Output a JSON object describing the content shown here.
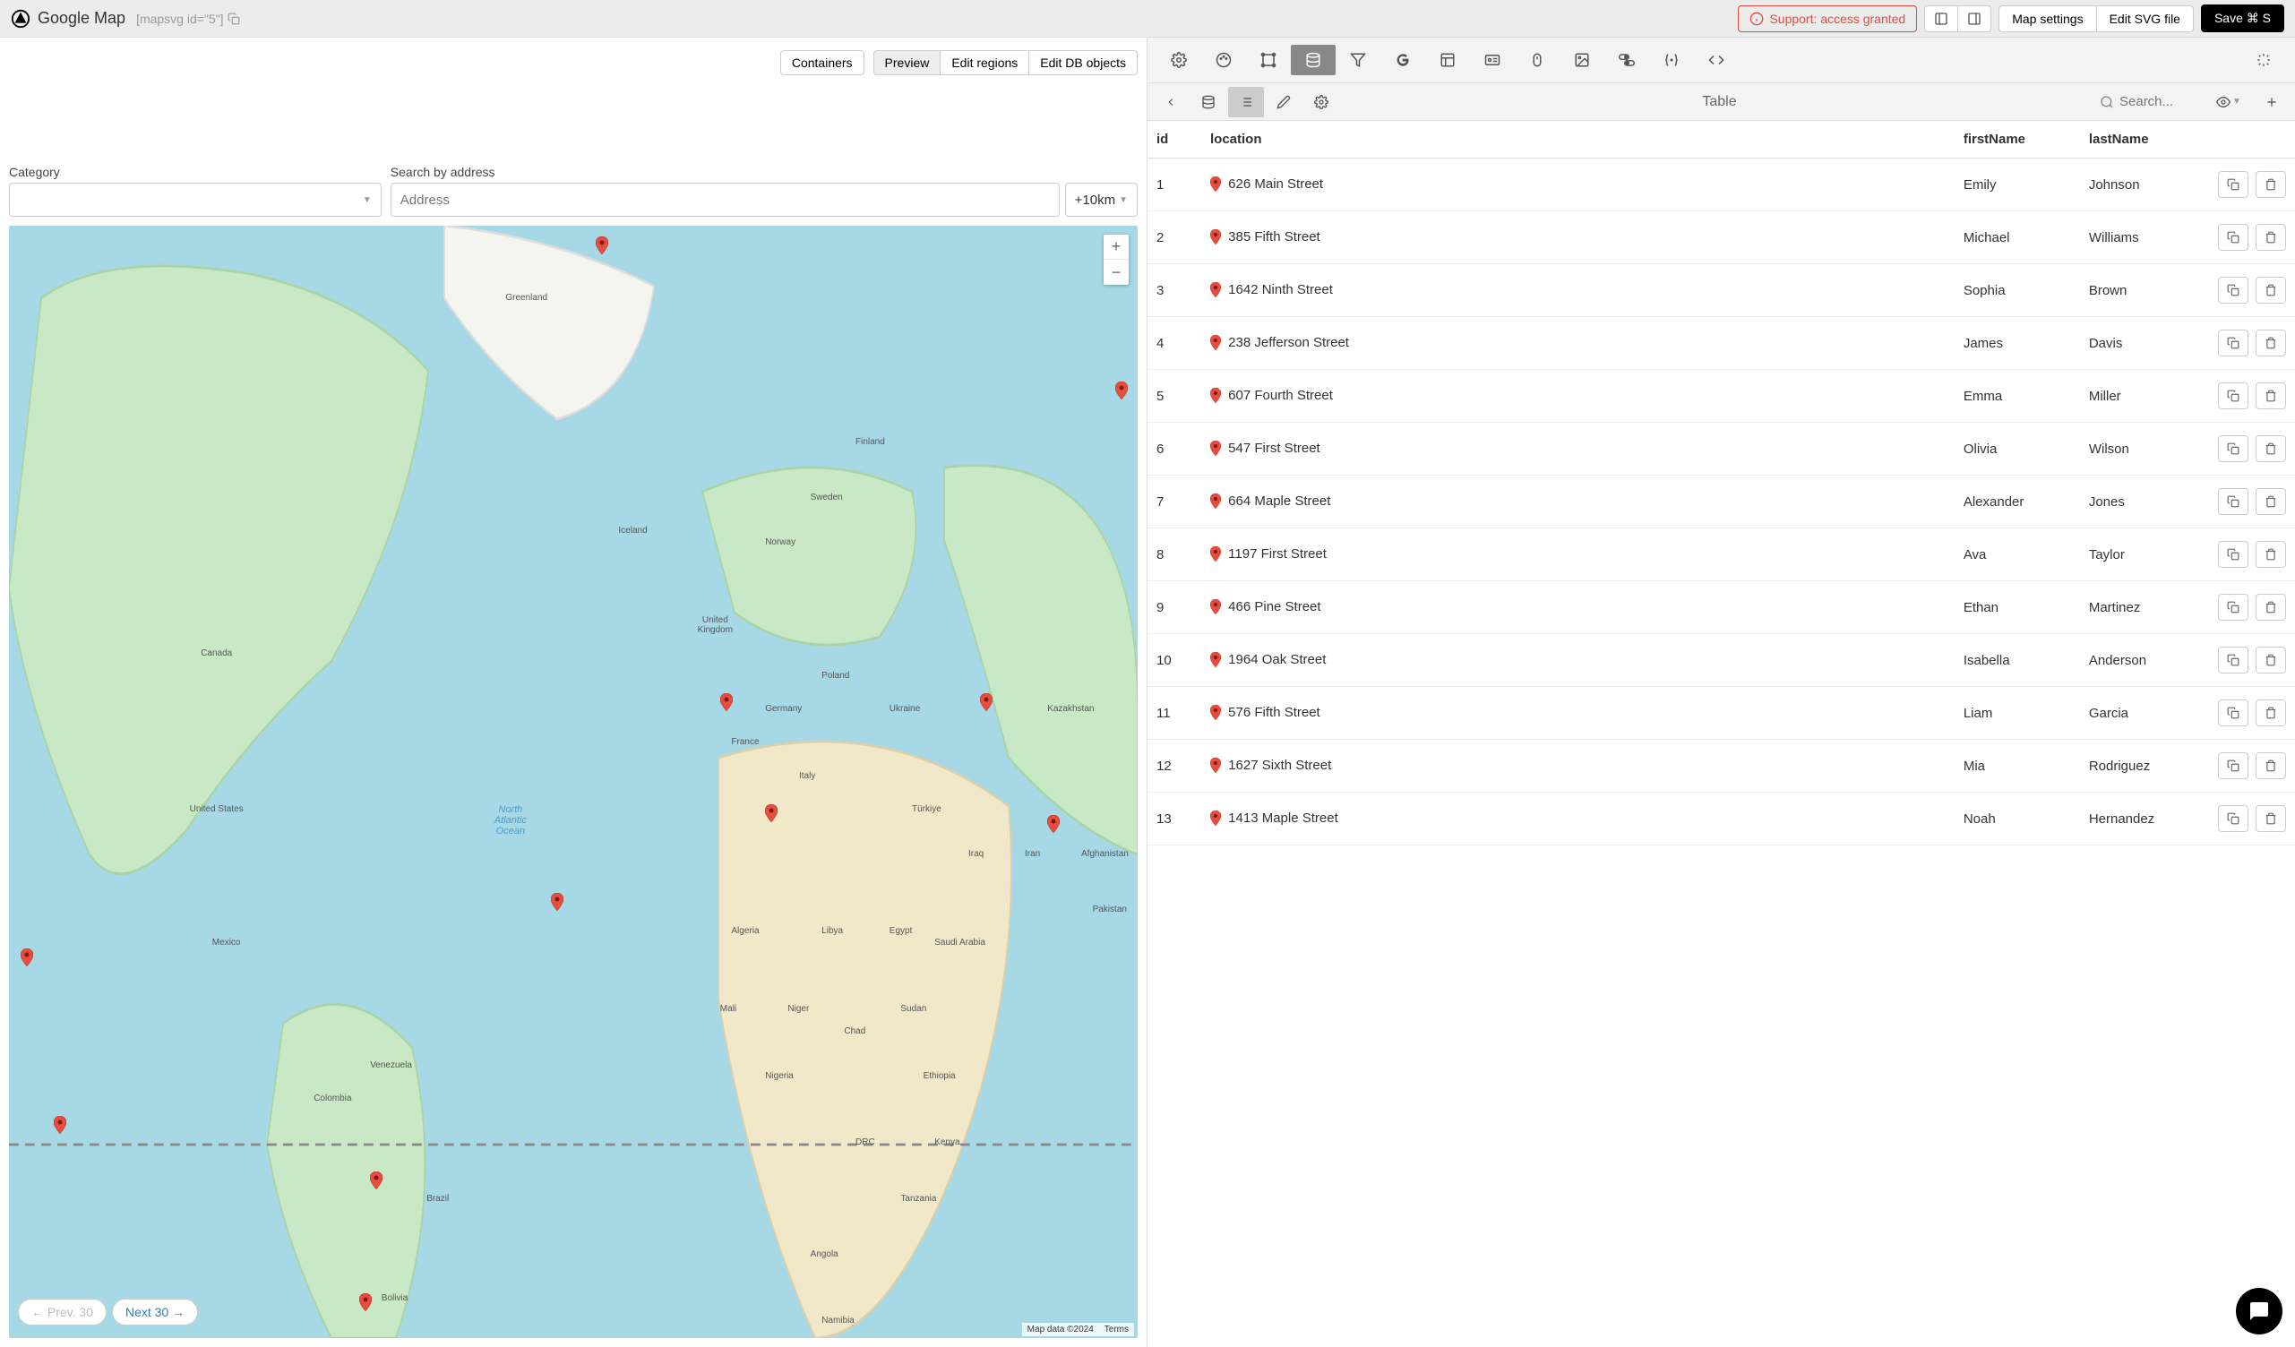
{
  "header": {
    "title": "Google Map",
    "mapId": "[mapsvg id=\"5\"]",
    "support": "Support: access granted",
    "mapSettings": "Map settings",
    "editSvg": "Edit SVG file",
    "save": "Save ⌘ S"
  },
  "leftTabs": {
    "containers": "Containers",
    "preview": "Preview",
    "editRegions": "Edit regions",
    "editDbObjects": "Edit DB objects"
  },
  "filters": {
    "categoryLabel": "Category",
    "addressLabel": "Search by address",
    "addressPlaceholder": "Address",
    "distance": "+10km"
  },
  "pager": {
    "prev": "← Prev. 30",
    "next": "Next 30 →"
  },
  "mapFooter": {
    "data": "Map data ©2024",
    "terms": "Terms"
  },
  "rightBar": {
    "tableLabel": "Table",
    "searchPlaceholder": "Search..."
  },
  "columns": {
    "id": "id",
    "location": "location",
    "firstName": "firstName",
    "lastName": "lastName"
  },
  "rows": [
    {
      "id": "1",
      "location": "626 Main Street",
      "firstName": "Emily",
      "lastName": "Johnson"
    },
    {
      "id": "2",
      "location": "385 Fifth Street",
      "firstName": "Michael",
      "lastName": "Williams"
    },
    {
      "id": "3",
      "location": "1642 Ninth Street",
      "firstName": "Sophia",
      "lastName": "Brown"
    },
    {
      "id": "4",
      "location": "238 Jefferson Street",
      "firstName": "James",
      "lastName": "Davis"
    },
    {
      "id": "5",
      "location": "607 Fourth Street",
      "firstName": "Emma",
      "lastName": "Miller"
    },
    {
      "id": "6",
      "location": "547 First Street",
      "firstName": "Olivia",
      "lastName": "Wilson"
    },
    {
      "id": "7",
      "location": "664 Maple Street",
      "firstName": "Alexander",
      "lastName": "Jones"
    },
    {
      "id": "8",
      "location": "1197 First Street",
      "firstName": "Ava",
      "lastName": "Taylor"
    },
    {
      "id": "9",
      "location": "466 Pine Street",
      "firstName": "Ethan",
      "lastName": "Martinez"
    },
    {
      "id": "10",
      "location": "1964 Oak Street",
      "firstName": "Isabella",
      "lastName": "Anderson"
    },
    {
      "id": "11",
      "location": "576 Fifth Street",
      "firstName": "Liam",
      "lastName": "Garcia"
    },
    {
      "id": "12",
      "location": "1627 Sixth Street",
      "firstName": "Mia",
      "lastName": "Rodriguez"
    },
    {
      "id": "13",
      "location": "1413 Maple Street",
      "firstName": "Noah",
      "lastName": "Hernandez"
    }
  ],
  "mapLabels": {
    "greenland": "Greenland",
    "iceland": "Iceland",
    "canada": "Canada",
    "us": "United States",
    "mexico": "Mexico",
    "venezuela": "Venezuela",
    "colombia": "Colombia",
    "brazil": "Brazil",
    "bolivia": "Bolivia",
    "finland": "Finland",
    "sweden": "Sweden",
    "norway": "Norway",
    "uk": "United\nKingdom",
    "poland": "Poland",
    "germany": "Germany",
    "ukraine": "Ukraine",
    "france": "France",
    "italy": "Italy",
    "turkiye": "Türkiye",
    "iraq": "Iraq",
    "iran": "Iran",
    "afghanistan": "Afghanistan",
    "pakistan": "Pakistan",
    "kazakhstan": "Kazakhstan",
    "saudi": "Saudi Arabia",
    "algeria": "Algeria",
    "libya": "Libya",
    "egypt": "Egypt",
    "mali": "Mali",
    "niger": "Niger",
    "chad": "Chad",
    "sudan": "Sudan",
    "nigeria": "Nigeria",
    "ethiopia": "Ethiopia",
    "kenya": "Kenya",
    "drc": "DRC",
    "tanzania": "Tanzania",
    "angola": "Angola",
    "namibia": "Namibia",
    "ocean": "North\nAtlantic\nOcean"
  }
}
